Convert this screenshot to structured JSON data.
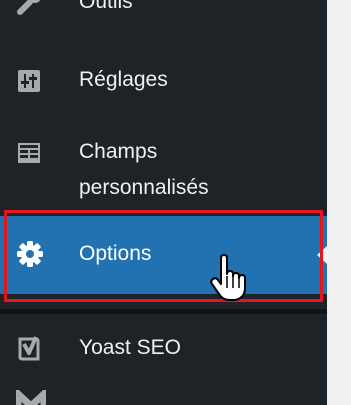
{
  "sidebar": {
    "items": [
      {
        "label": "Outils",
        "icon": "wrench-icon"
      },
      {
        "label": "Réglages",
        "icon": "settings-sliders-icon"
      },
      {
        "label": "Champs personnalisés",
        "icon": "custom-fields-icon"
      },
      {
        "label": "Options",
        "icon": "gear-icon",
        "active": true
      },
      {
        "label": "Yoast SEO",
        "icon": "yoast-icon"
      },
      {
        "label": "",
        "icon": "mailchimp-icon"
      }
    ]
  },
  "colors": {
    "sidebar_background": "#1d2327",
    "active_background": "#2271b1",
    "highlight_frame": "#e4151f",
    "page_background": "#f0f0f1",
    "text": "#f0f0f1"
  },
  "cursor": {
    "type": "hand-pointer"
  }
}
